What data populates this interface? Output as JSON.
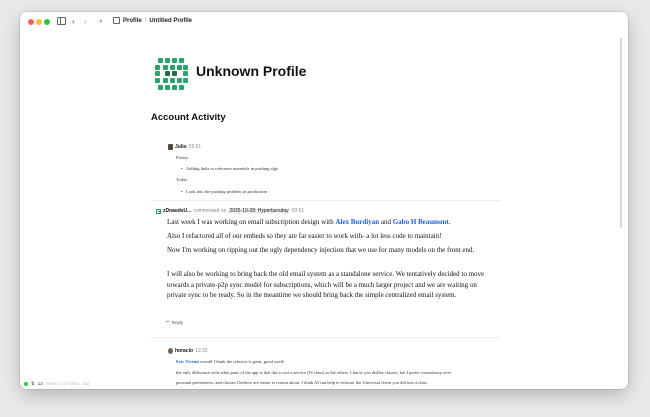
{
  "breadcrumb": {
    "root": "Profile",
    "current": "Untitled Profile"
  },
  "profile": {
    "title": "Unknown Profile"
  },
  "section": {
    "title": "Account Activity"
  },
  "entry1": {
    "author": "Julio",
    "time": "09:51",
    "friday_label": "Friday:",
    "friday_item": "Adding links to reference materials in pushing algo",
    "today_label": "Today:",
    "today_item": "Look into the pushing problem in production"
  },
  "entry2": {
    "author": "zDnaedsU...",
    "action": "commented on",
    "tag": "2025-10-28: Hypertuesday",
    "time": "09:51",
    "p1_pre": "Last week I was working on email subscription design with",
    "link1": "Alex Burdiyan",
    "and": "and",
    "link2": "Gabo H Beaumont",
    "period": ".",
    "p2": "Also I refactored all of our embeds so they are far easier to work with- a lot less code to maintain!",
    "p3": "Now I'm working on ripping out the ugly dependency injection that we use for many models on the front end.",
    "p4": "I will also be working to bring back the old email system as a standalone service. We tentatively decided to move towards a private-p2p sync model for subscriptions, which will be a much larger project and we are waiting on private sync to be ready. So in the meantime we should bring back the simple centralized email system.",
    "reply_label": "Reply"
  },
  "entry3": {
    "author": "horacio",
    "time": "13:33",
    "mention": "Eric Vicenti",
    "line1": "overall I think the refactor is great, good work!",
    "line2": "the only difference with other parts of the app is that this is not a service (JS class) as the others. I know you dislike classes, but I prefer consistency over",
    "line3": "personal preferences. and classes I believe are easier to reason about. I think AI can help to refactor the Universal client you did into a class."
  },
  "status": {
    "count": "13",
    "faint": "Seed 0.1.0 (2CA...ab)"
  },
  "colors": {
    "accent": "#2aa36a",
    "link": "#1d5fd6"
  }
}
